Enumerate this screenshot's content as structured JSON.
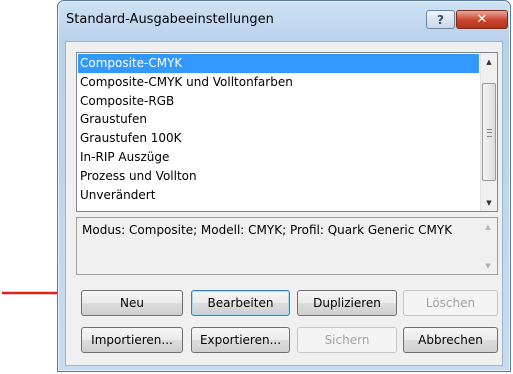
{
  "dialog": {
    "title": "Standard-Ausgabeeinstellungen",
    "help_glyph": "?",
    "close_glyph": "✕"
  },
  "list": {
    "items": [
      "Composite-CMYK",
      "Composite-CMYK und Volltonfarben",
      "Composite-RGB",
      "Graustufen",
      "Graustufen 100K",
      "In-RIP Auszüge",
      "Prozess und Vollton",
      "Unverändert"
    ],
    "selected_index": 0
  },
  "description": "Modus: Composite; Modell: CMYK; Profil: Quark Generic CMYK",
  "buttons": {
    "neu": "Neu",
    "bearbeiten": "Bearbeiten",
    "duplizieren": "Duplizieren",
    "loeschen": "Löschen",
    "importieren": "Importieren...",
    "exportieren": "Exportieren...",
    "sichern": "Sichern",
    "abbrechen": "Abbrechen"
  },
  "colors": {
    "selection": "#3399ff",
    "annotation_arrow": "#e2211c",
    "close_button": "#c8432b"
  }
}
